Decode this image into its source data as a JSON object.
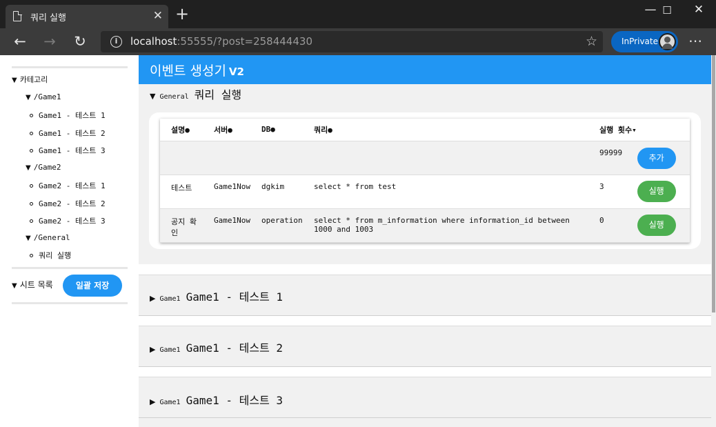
{
  "browser": {
    "tab_title": "쿼리 실행",
    "tab_close": "✕",
    "new_tab": "+",
    "url_host": "localhost",
    "url_rest": ":55555/?post=258444430",
    "inprivate_label": "InPrivate",
    "window_minimize": "—",
    "window_maximize": "☐",
    "window_close": "✕"
  },
  "app": {
    "title": "이벤트 생성기",
    "version": "V2"
  },
  "sidebar": {
    "category_label": "카테고리",
    "groups": [
      {
        "label": "/Game1",
        "items": [
          "Game1 - 테스트 1",
          "Game1 - 테스트 2",
          "Game1 - 테스트 3"
        ]
      },
      {
        "label": "/Game2",
        "items": [
          "Game2 - 테스트 1",
          "Game2 - 테스트 2",
          "Game2 - 테스트 3"
        ]
      },
      {
        "label": "/General",
        "items": [
          "쿼리 실행"
        ]
      }
    ],
    "sheet_list_label": "시트 목록",
    "save_all_label": "일괄 저장"
  },
  "sections": {
    "active": {
      "prefix": "General",
      "title": "쿼리 실행"
    },
    "collapsed": [
      {
        "prefix": "Game1",
        "title": "Game1 - 테스트 1"
      },
      {
        "prefix": "Game1",
        "title": "Game1 - 테스트 2"
      },
      {
        "prefix": "Game1",
        "title": "Game1 - 테스트 3"
      }
    ]
  },
  "query_table": {
    "headers": [
      "설명●",
      "서버●",
      "DB●",
      "쿼리●",
      "실행 횟수▾"
    ],
    "new_row": {
      "count": "99999",
      "button": "추가"
    },
    "rows": [
      {
        "desc": "테스트",
        "server": "Game1Now",
        "db": "dgkim",
        "query": "select * from test",
        "count": "3",
        "button": "실행"
      },
      {
        "desc": "공지 확인",
        "server": "Game1Now",
        "db": "operation",
        "query": "select * from m_information where information_id between 1000 and 1003",
        "count": "0",
        "button": "실행"
      }
    ]
  }
}
